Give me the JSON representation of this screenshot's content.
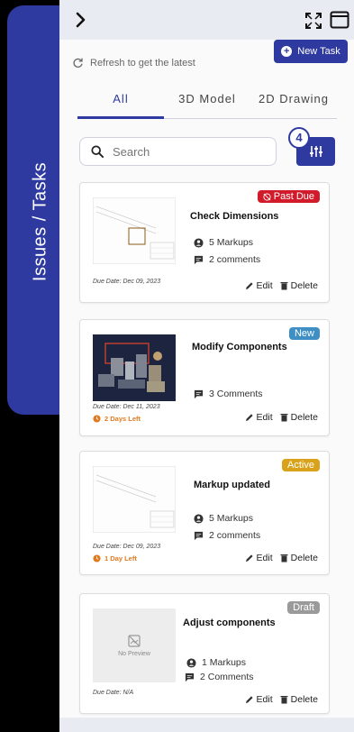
{
  "side_tab": {
    "label": "Issues / Tasks"
  },
  "header": {
    "new_task_label": "New Task",
    "refresh_label": "Refresh to get the latest"
  },
  "tabs": [
    {
      "label": "All",
      "active": true
    },
    {
      "label": "3D Model",
      "active": false
    },
    {
      "label": "2D Drawing",
      "active": false
    }
  ],
  "search": {
    "placeholder": "Search"
  },
  "filter": {
    "count": "4"
  },
  "cards": [
    {
      "title": "Check Dimensions",
      "badge": "Past Due",
      "badge_color": "#d11a2a",
      "markups": "5 Markups",
      "comments": "2 comments",
      "due": "Due Date: Dec 09, 2023",
      "days_left": "",
      "edit": "Edit",
      "delete": "Delete",
      "thumb": "drawing"
    },
    {
      "title": "Modify Components",
      "badge": "New",
      "badge_color": "#3f8fc4",
      "markups": "",
      "comments": "3 Comments",
      "due": "Due Date: Dec 11, 2023",
      "days_left": "2 Days Left",
      "edit": "Edit",
      "delete": "Delete",
      "thumb": "model"
    },
    {
      "title": "Markup updated",
      "badge": "Active",
      "badge_color": "#d9a21b",
      "markups": "5 Markups",
      "comments": "2 comments",
      "due": "Due Date: Dec 09, 2023",
      "days_left": "1 Day Left",
      "edit": "Edit",
      "delete": "Delete",
      "thumb": "drawing"
    },
    {
      "title": "Adjust components",
      "badge": "Draft",
      "badge_color": "#9a9a9a",
      "markups": "1 Markups",
      "comments": "2 Comments",
      "due": "Due Date: N/A",
      "days_left": "",
      "edit": "Edit",
      "delete": "Delete",
      "thumb": "none",
      "no_preview": "No Preview"
    }
  ],
  "colors": {
    "primary": "#2f3aa0",
    "warning": "#e07a1f"
  }
}
